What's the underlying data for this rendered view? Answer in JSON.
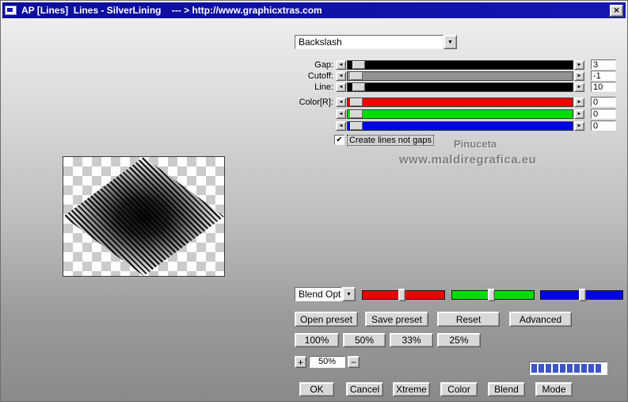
{
  "window": {
    "title": "AP [Lines]  Lines - SilverLining    --- > http://www.graphicxtras.com"
  },
  "colors": {
    "titlebar": "linear-gradient(90deg,#0c0c9c,#1717b2)",
    "progress_fill": "#3c55c8"
  },
  "icons": {
    "close": "✕",
    "dropdown": "▼",
    "left_arrow": "◄",
    "right_arrow": "►",
    "check": "✔"
  },
  "preset_dropdown": {
    "value": "Backslash"
  },
  "sliders": [
    {
      "label": "Gap:",
      "value": "3",
      "track_color": "#000000",
      "thumb_left": "2%"
    },
    {
      "label": "Cutoff:",
      "value": "-1",
      "track_color": "#929292",
      "thumb_left": "1%"
    },
    {
      "label": "Line:",
      "value": "10",
      "track_color": "#000000",
      "thumb_left": "2%"
    },
    {
      "label": "Color[R]:",
      "value": "0",
      "track_color": "#ee0000",
      "thumb_left": "1%"
    },
    {
      "label": "",
      "value": "0",
      "track_color": "#00dd00",
      "thumb_left": "1%"
    },
    {
      "label": "",
      "value": "0",
      "track_color": "#0000ee",
      "thumb_left": "1%"
    }
  ],
  "checkbox": {
    "label": "Create lines not gaps",
    "checked": true
  },
  "watermark": {
    "line1": "Pinuceta",
    "line2": "www.maldiregrafica.eu"
  },
  "blend_dropdown": {
    "value": "Blend Opti"
  },
  "rgb_sliders": [
    {
      "name": "red",
      "color": "#ee0000",
      "thumb_left": "44%"
    },
    {
      "name": "green",
      "color": "#00dd00",
      "thumb_left": "44%"
    },
    {
      "name": "blue",
      "color": "#0000ee",
      "thumb_left": "47%"
    }
  ],
  "buttons": {
    "open_preset": "Open preset",
    "save_preset": "Save preset",
    "reset": "Reset",
    "advanced": "Advanced",
    "zoom_100": "100%",
    "zoom_50": "50%",
    "zoom_33": "33%",
    "zoom_25": "25%",
    "plus": "+",
    "minus": "−",
    "ok": "OK",
    "cancel": "Cancel",
    "xtreme": "Xtreme",
    "color": "Color",
    "blend": "Blend",
    "mode": "Mode"
  },
  "zoom_value": "50%",
  "progress": {
    "filled": 10,
    "total": 10
  }
}
